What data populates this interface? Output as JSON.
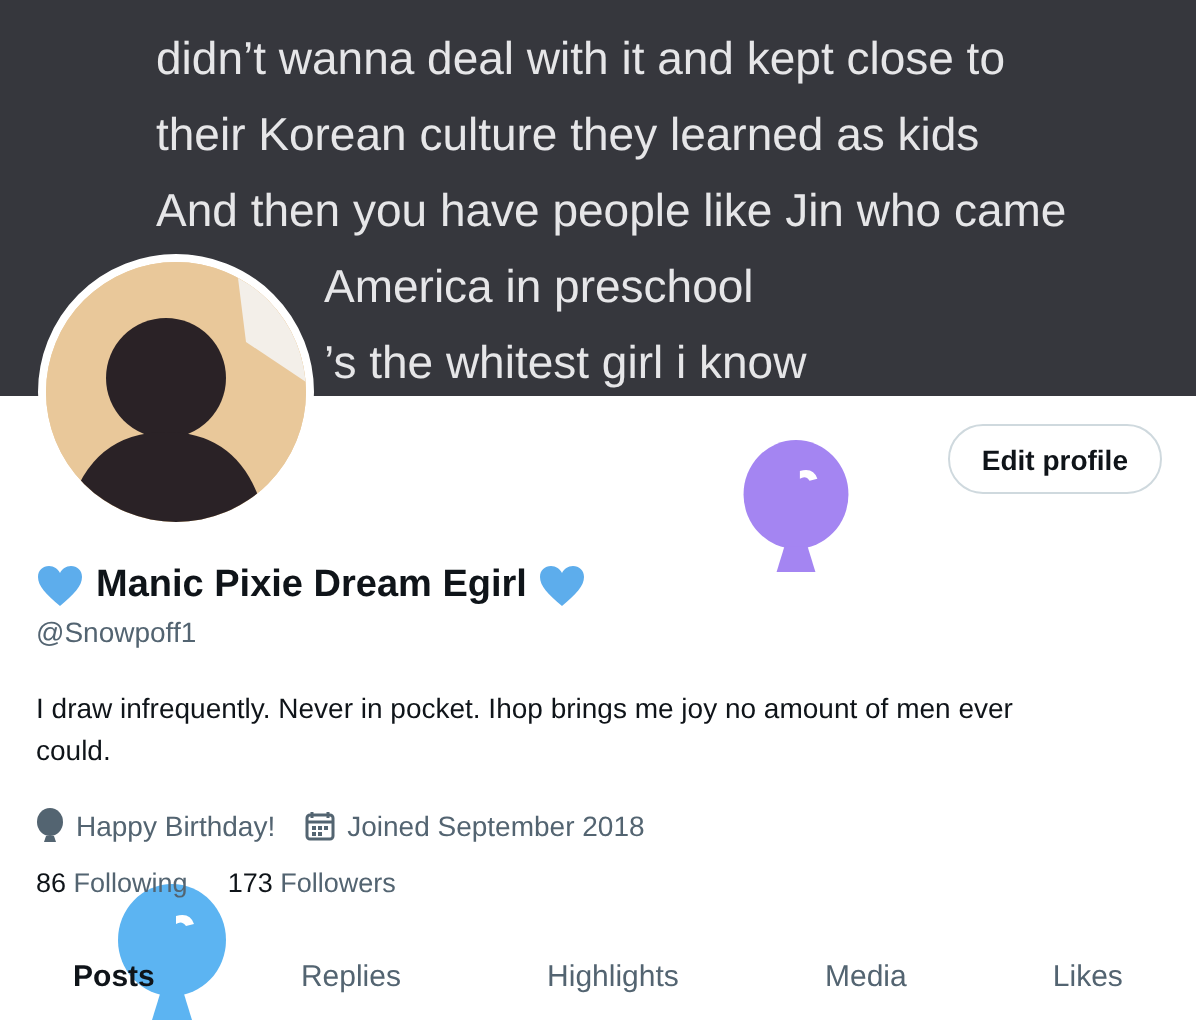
{
  "banner": {
    "lines": [
      {
        "text": "didn’t wanna deal with it and kept close to",
        "beside_avatar": false
      },
      {
        "text": "their Korean culture they learned as kids",
        "beside_avatar": false
      },
      {
        "text": "And then you have people like Jin who came",
        "beside_avatar": false
      },
      {
        "text": "America in preschool",
        "beside_avatar": true
      },
      {
        "text": "’s the whitest girl i know",
        "beside_avatar": true
      }
    ]
  },
  "edit_button": "Edit profile",
  "name": "Manic Pixie Dream Egirl",
  "handle": "@Snowpoff1",
  "bio": "I draw infrequently. Never in pocket. Ihop brings me joy no amount of men ever could.",
  "meta": [
    {
      "kind": "balloon",
      "text": "Happy Birthday!"
    },
    {
      "kind": "calendar",
      "text": "Joined September 2018"
    }
  ],
  "stats": [
    {
      "count": "86",
      "label": "Following"
    },
    {
      "count": "173",
      "label": "Followers"
    }
  ],
  "tabs": [
    {
      "label": "Posts",
      "selected": true
    },
    {
      "label": "Replies",
      "selected": false
    },
    {
      "label": "Highlights",
      "selected": false
    },
    {
      "label": "Media",
      "selected": false
    },
    {
      "label": "Likes",
      "selected": false
    }
  ]
}
